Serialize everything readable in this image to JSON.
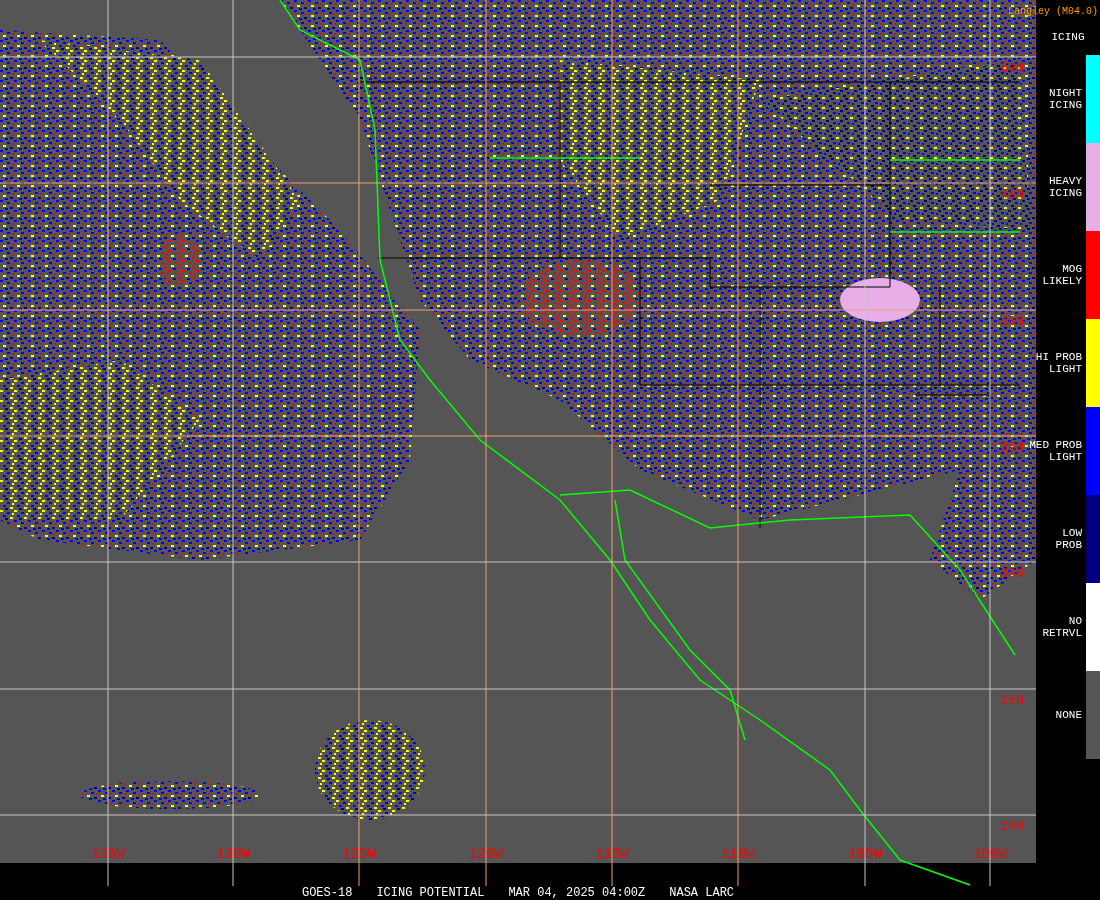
{
  "header": {
    "source": "Langley (M04.0)",
    "legend_title": "ICING"
  },
  "legend": [
    {
      "lines": [
        "NIGHT",
        "ICING"
      ],
      "color": "#00ffff"
    },
    {
      "lines": [
        "HEAVY",
        "ICING"
      ],
      "color": "#e8aee8"
    },
    {
      "lines": [
        "MOG",
        "LIKELY"
      ],
      "color": "#ff0000"
    },
    {
      "lines": [
        "HI PROB",
        "LIGHT"
      ],
      "color": "#ffff00"
    },
    {
      "lines": [
        "MED PROB",
        "LIGHT"
      ],
      "color": "#0000ff"
    },
    {
      "lines": [
        "LOW",
        "PROB"
      ],
      "color": "#000080"
    },
    {
      "lines": [
        "NO",
        "RETRVL"
      ],
      "color": "#ffffff"
    },
    {
      "lines": [
        "NONE"
      ],
      "color": "#555555"
    }
  ],
  "map": {
    "latitude_labels": [
      "50N",
      "45N",
      "40N",
      "35N",
      "30N",
      "25N",
      "20N"
    ],
    "longitude_labels": [
      "135W",
      "130W",
      "125W",
      "120W",
      "115W",
      "110W",
      "105W",
      "100W"
    ]
  },
  "footer": [
    "GOES-18",
    "ICING POTENTIAL",
    "MAR 04, 2025 04:00Z",
    "NASA LARC"
  ]
}
